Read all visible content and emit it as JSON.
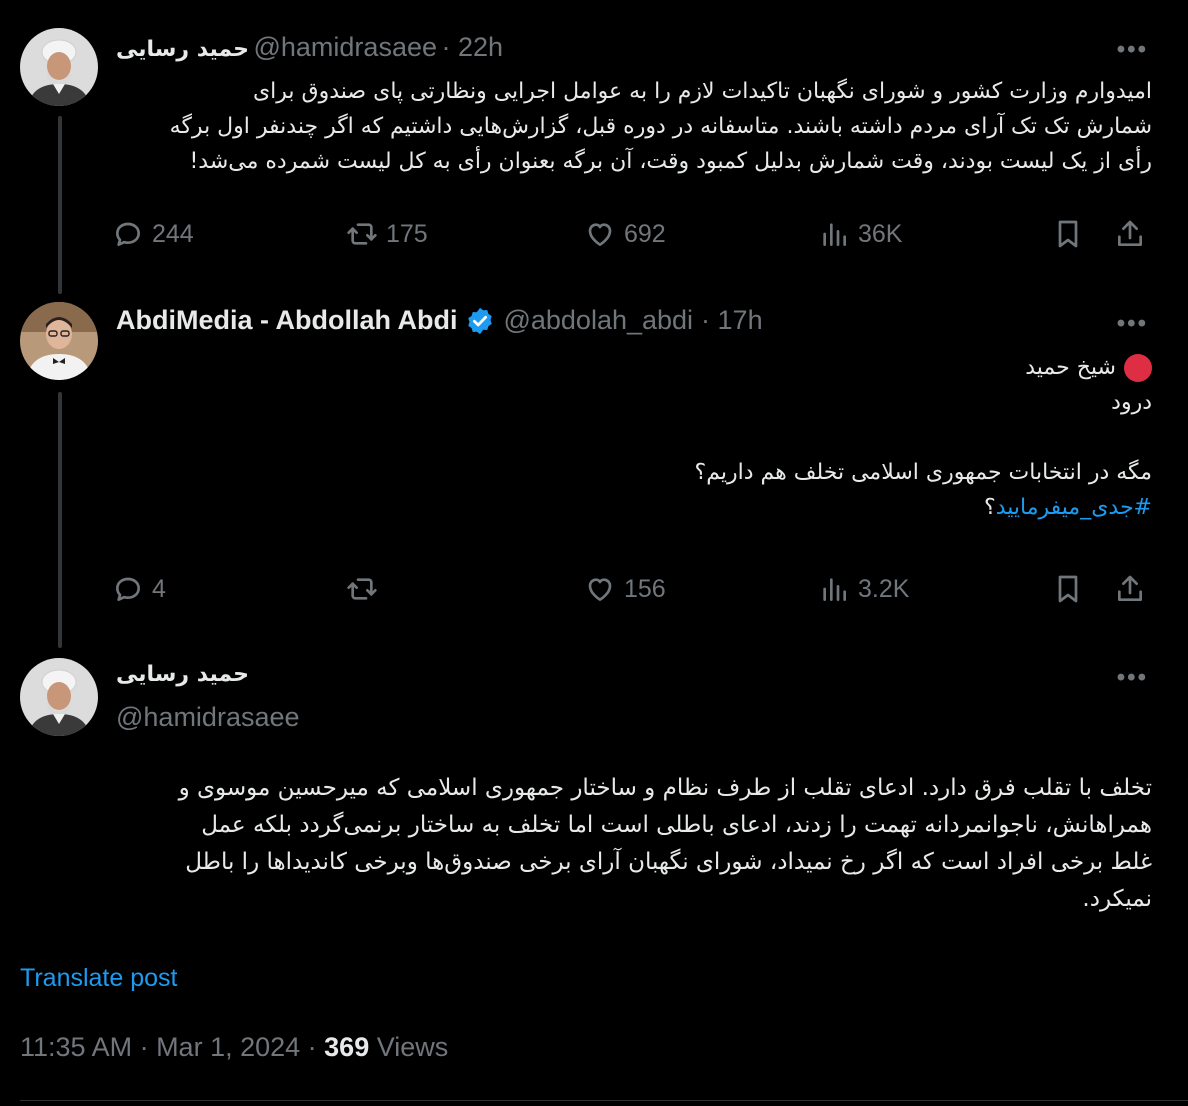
{
  "tweet1": {
    "name": "حمید رسایی",
    "handle": "@hamidrasaee",
    "time": "· 22h",
    "lines": [
      "امیدوارم وزارت کشور و شورای نگهبان تاکیدات لازم را به عوامل اجرایی ونظارتی پای صندوق برای",
      "شمارش تک تک آرای مردم داشته باشند. متاسفانه در دوره قبل، گزارش‌هایی داشتیم که اگر چندنفر اول برگه",
      "رأی از یک لیست بودند، وقت شمارش بدلیل کمبود وقت، آن برگه بعنوان رأی به کل لیست شمرده می‌شد!"
    ],
    "stats": {
      "replies": "244",
      "reposts": "175",
      "likes": "692",
      "views": "36K"
    }
  },
  "tweet2": {
    "name": "AbdiMedia - Abdollah Abdi",
    "handle": "@abdolah_abdi",
    "time": "· 17h",
    "lines": [
      "شیخ حمید",
      "درود",
      "مگه در انتخابات جمهوری اسلامی تخلف هم داریم؟",
      "#جدی_میفرمایید",
      "؟"
    ],
    "stats": {
      "replies": "4",
      "reposts": "",
      "likes": "156",
      "views": "3.2K"
    }
  },
  "tweet3": {
    "name": "حمید رسایی",
    "handle": "@hamidrasaee",
    "lines": [
      "تخلف با تقلب فرق دارد. ادعای تقلب از طرف نظام و ساختار جمهوری اسلامی که میرحسین موسوی و",
      "همراهانش، ناجوانمردانه تهمت را زدند، ادعای باطلی است اما تخلف به ساختار برنمی‌گردد بلکه عمل",
      "غلط برخی افراد است که اگر رخ نمیداد، شورای نگهبان آرای برخی صندوق‌ها وبرخی کاندیداها را باطل",
      "نمیکرد."
    ],
    "translate": "Translate post",
    "time": "11:35 AM · Mar 1, 2024 · ",
    "views_count": "369",
    "views_label": " Views"
  },
  "more_label": "•••",
  "colors": {
    "accent": "#1d9bf0",
    "muted": "#71767b",
    "verified": "#1d9bf0",
    "circle": "#e0245e"
  }
}
